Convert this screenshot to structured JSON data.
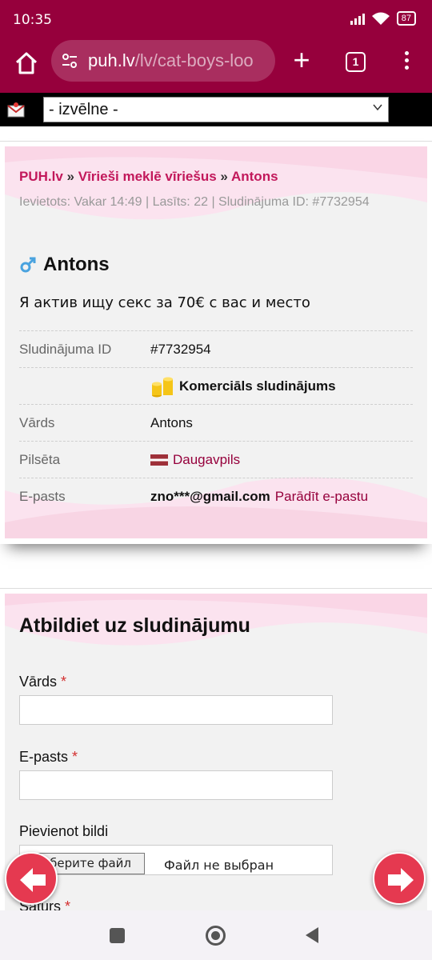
{
  "status": {
    "time": "10:35",
    "battery": "87"
  },
  "browser": {
    "url_host": "puh.lv",
    "url_path": "/lv/cat-boys-loo",
    "tab_count": "1"
  },
  "sitenav": {
    "menu_selected": "- izvēlne -"
  },
  "listing": {
    "breadcrumb": [
      "PUH.lv",
      "Vīrieši meklē vīriešus",
      "Antons"
    ],
    "breadcrumb_sep": "»",
    "meta": "Ievietots: Vakar 14:49 | Lasīts: 22 | Sludinājuma ID: #7732954",
    "title": "Antons",
    "description": "Я актив ищу секс за 70€ с вас и место",
    "rows": [
      {
        "key": "Sludinājuma ID",
        "value": "#7732954"
      },
      {
        "key": "",
        "value": "Komerciāls sludinājums"
      },
      {
        "key": "Vārds",
        "value": "Antons"
      },
      {
        "key": "Pilsēta",
        "value": "Daugavpils"
      },
      {
        "key": "E-pasts",
        "value": "zno***@gmail.com",
        "link": "Parādīt e-pastu"
      }
    ]
  },
  "reply_form": {
    "title": "Atbildiet uz sludinājumu",
    "name_label": "Vārds",
    "email_label": "E-pasts",
    "picture_label": "Pievienot bildi",
    "file_button": "Выберите файл",
    "file_none": "Файл не выбран",
    "content_label": "Saturs",
    "required_mark": "*"
  },
  "colors": {
    "brand": "#96003c",
    "link": "#c2185b",
    "required": "#d32f2f",
    "arrow": "#e53950"
  },
  "icons": [
    "home-icon",
    "site-settings-icon",
    "plus-icon",
    "tab-switcher-icon",
    "more-icon",
    "mail-logo-icon",
    "gender-icon",
    "coins-icon",
    "latvia-flag-icon",
    "arrow-left-icon",
    "arrow-right-icon"
  ]
}
